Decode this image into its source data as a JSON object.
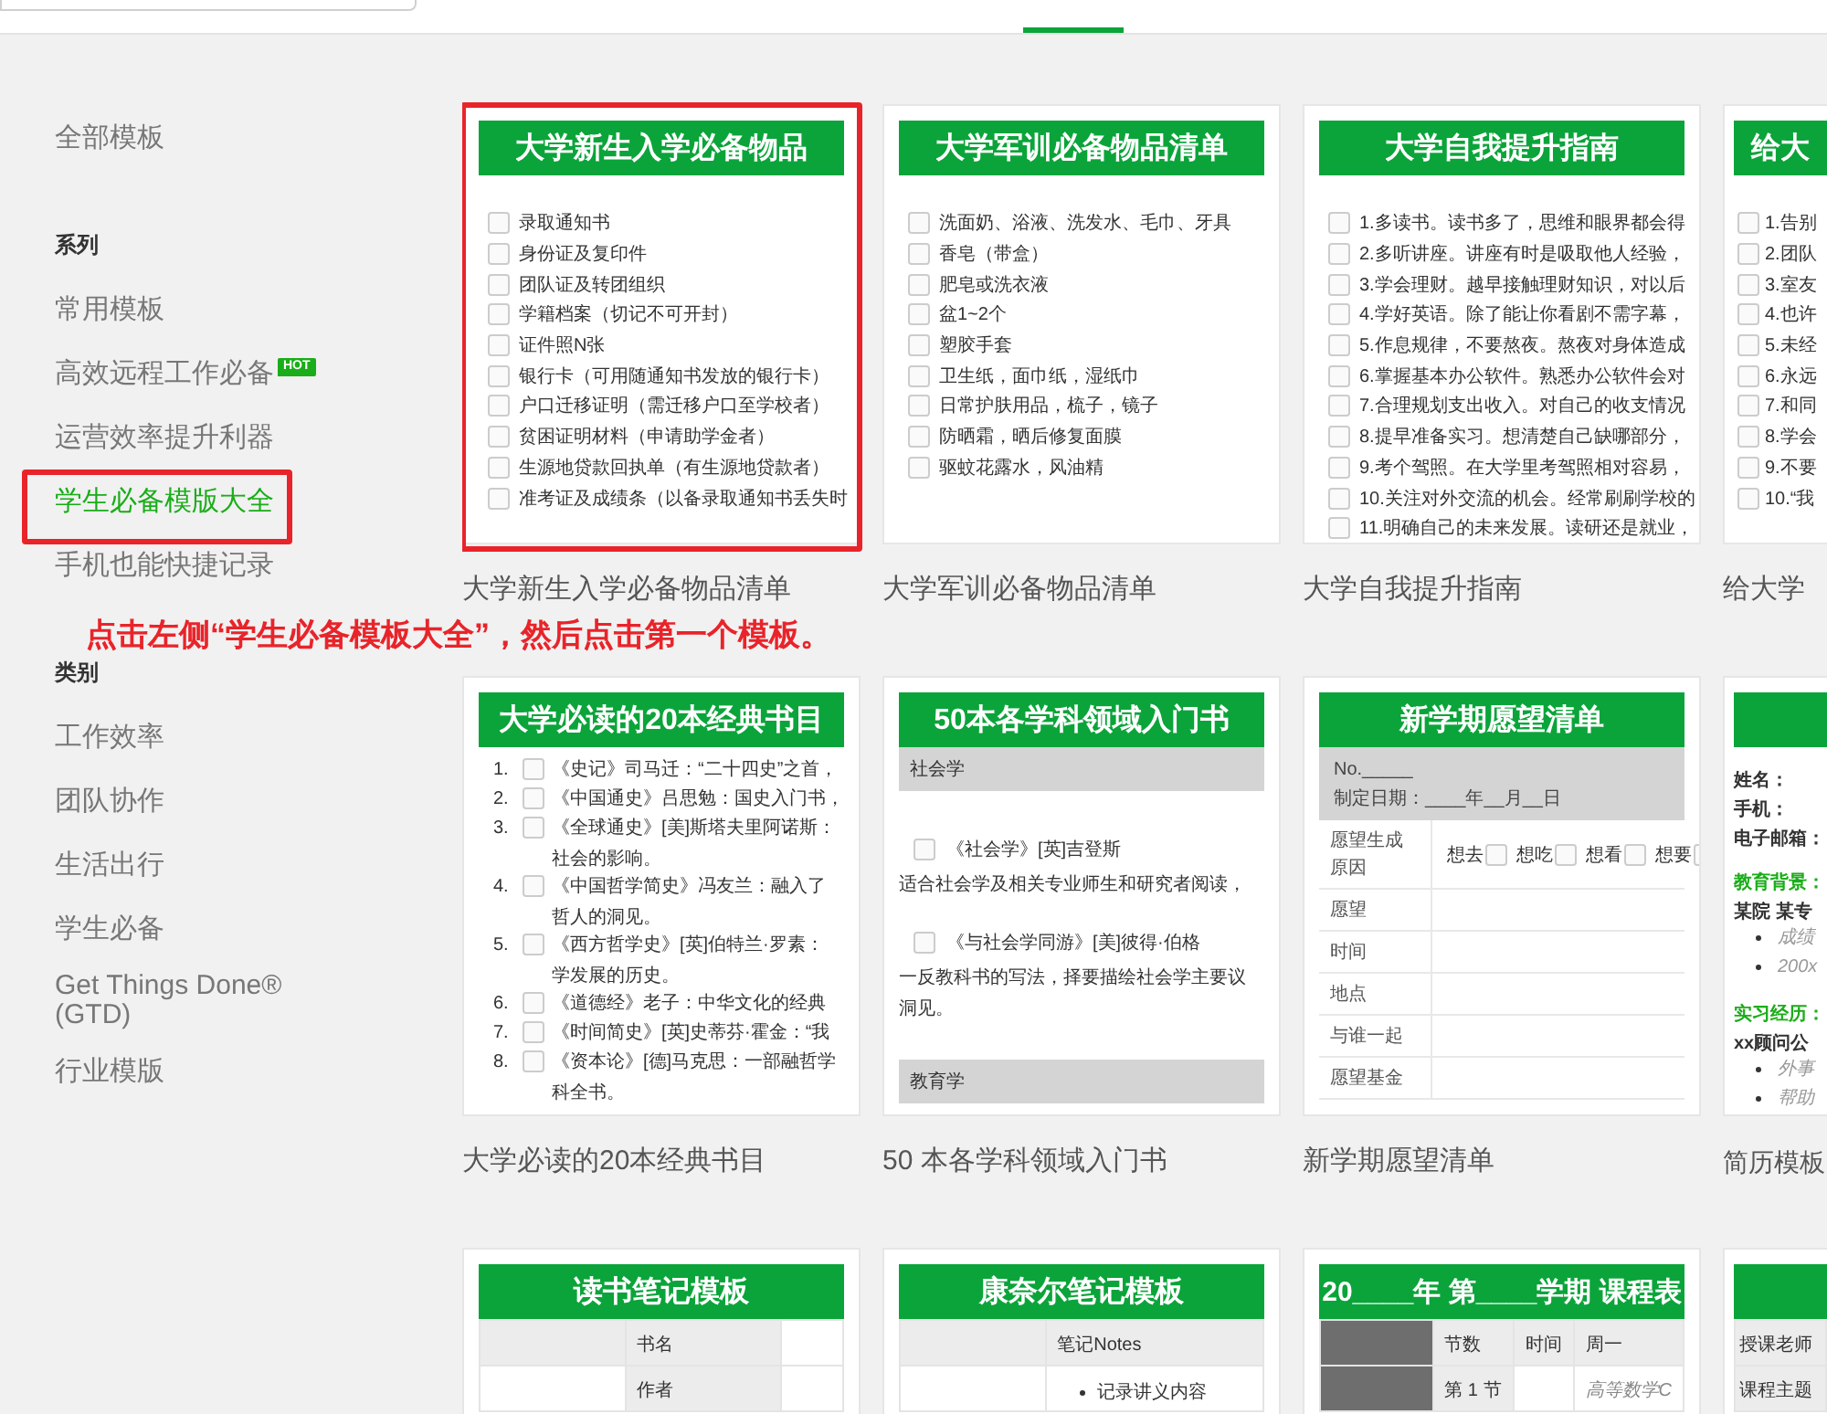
{
  "sidebar": {
    "top_items": [
      {
        "label": "全部模板",
        "selected": false,
        "highlighted": false
      }
    ],
    "sections": [
      {
        "heading": "系列",
        "items": [
          {
            "label": "常用模板",
            "selected": false,
            "highlighted": false
          },
          {
            "label": "高效远程工作必备",
            "selected": false,
            "highlighted": false,
            "badge": "HOT"
          },
          {
            "label": "运营效率提升利器",
            "selected": false,
            "highlighted": false
          },
          {
            "label": "学生必备模版大全",
            "selected": true,
            "highlighted": true
          },
          {
            "label": "手机也能快捷记录",
            "selected": false,
            "highlighted": false
          }
        ]
      },
      {
        "heading": "类别",
        "items": [
          {
            "label": "工作效率",
            "selected": false,
            "highlighted": false
          },
          {
            "label": "团队协作",
            "selected": false,
            "highlighted": false
          },
          {
            "label": "生活出行",
            "selected": false,
            "highlighted": false
          },
          {
            "label": "学生必备",
            "selected": false,
            "highlighted": false
          },
          {
            "label": "Get Things Done® (GTD)",
            "selected": false,
            "highlighted": false
          },
          {
            "label": "行业模版",
            "selected": false,
            "highlighted": false
          }
        ]
      }
    ]
  },
  "instruction": "点击左侧“学生必备模板大全”，然后点击第一个模板。",
  "templates": [
    {
      "caption": "大学新生入学必备物品清单",
      "highlighted": true,
      "preview": {
        "kind": "checklist",
        "title": "大学新生入学必备物品",
        "items": [
          "录取通知书",
          "身份证及复印件",
          "团队证及转团组织",
          "学籍档案（切记不可开封）",
          "证件照N张",
          "银行卡（可用随通知书发放的银行卡）",
          "户口迁移证明（需迁移户口至学校者）",
          "贫困证明材料（申请助学金者）",
          "生源地贷款回执单（有生源地贷款者）",
          "准考证及成绩条（以备录取通知书丢失时"
        ]
      }
    },
    {
      "caption": "大学军训必备物品清单",
      "highlighted": false,
      "preview": {
        "kind": "checklist",
        "title": "大学军训必备物品清单",
        "items": [
          "洗面奶、浴液、洗发水、毛巾、牙具",
          "香皂（带盒）",
          "肥皂或洗衣液",
          "盆1~2个",
          "塑胶手套",
          "卫生纸，面巾纸，湿纸巾",
          "日常护肤用品，梳子，镜子",
          "防晒霜，晒后修复面膜",
          "驱蚊花露水，风油精"
        ]
      }
    },
    {
      "caption": "大学自我提升指南",
      "highlighted": false,
      "preview": {
        "kind": "checklist",
        "title": "大学自我提升指南",
        "items": [
          "1.多读书。读书多了，思维和眼界都会得",
          "2.多听讲座。讲座有时是吸取他人经验，",
          "3.学会理财。越早接触理财知识，对以后",
          "4.学好英语。除了能让你看剧不需字幕，",
          "5.作息规律，不要熬夜。熬夜对身体造成",
          "6.掌握基本办公软件。熟悉办公软件会对",
          "7.合理规划支出收入。对自己的收支情况",
          "8.提早准备实习。想清楚自己缺哪部分，",
          "9.考个驾照。在大学里考驾照相对容易，",
          "10.关注对外交流的机会。经常刷刷学校的",
          "11.明确自己的未来发展。读研还是就业，"
        ]
      }
    },
    {
      "caption": "给大学",
      "highlighted": false,
      "preview": {
        "kind": "checklist",
        "title": "给大",
        "items": [
          "1.告别",
          "2.团队",
          "3.室友",
          "4.也许",
          "5.未经",
          "6.永远",
          "7.和同",
          "8.学会",
          "9.不要",
          "10.“我"
        ]
      }
    },
    {
      "caption": "大学必读的20本经典书目",
      "highlighted": false,
      "preview": {
        "kind": "booklist",
        "title": "大学必读的20本经典书目",
        "items": [
          {
            "number": "1.",
            "text": "《史记》司马迁：“二十四史”之首，"
          },
          {
            "number": "2.",
            "text": "《中国通史》吕思勉：国史入门书，"
          },
          {
            "number": "3.",
            "text": "《全球通史》[美]斯塔夫里阿诺斯：",
            "more": "社会的影响。"
          },
          {
            "number": "4.",
            "text": "《中国哲学简史》冯友兰：融入了",
            "more": "哲人的洞见。"
          },
          {
            "number": "5.",
            "text": "《西方哲学史》[英]伯特兰·罗素：",
            "more": "学发展的历史。"
          },
          {
            "number": "6.",
            "text": "《道德经》老子：中华文化的经典"
          },
          {
            "number": "7.",
            "text": "《时间简史》[英]史蒂芬·霍金：“我"
          },
          {
            "number": "8.",
            "text": "《资本论》[德]马克思：一部融哲学",
            "more": "科全书。"
          }
        ]
      }
    },
    {
      "caption": "50 本各学科领域入门书",
      "highlighted": false,
      "preview": {
        "kind": "sections",
        "title": "50本各学科领域入门书",
        "sections": [
          {
            "name": "社会学",
            "entries": [
              {
                "title": "《社会学》[英]吉登斯",
                "note": [
                  "适合社会学及相关专业师生和研究者阅读，"
                ]
              },
              {
                "title": "《与社会学同游》[美]彼得·伯格",
                "note": [
                  "一反教科书的写法，择要描绘社会学主要议",
                  "洞见。"
                ]
              }
            ]
          },
          {
            "name": "教育学"
          }
        ]
      }
    },
    {
      "caption": "新学期愿望清单",
      "highlighted": false,
      "preview": {
        "kind": "form",
        "title": "新学期愿望清单",
        "meta": [
          "No._____",
          "制定日期：____年__月__日"
        ],
        "rows": [
          {
            "label": "愿望生成原因",
            "options": [
              "想去",
              "想吃",
              "想看",
              "想要"
            ]
          },
          {
            "label": "愿望"
          },
          {
            "label": "时间"
          },
          {
            "label": "地点"
          },
          {
            "label": "与谁一起"
          },
          {
            "label": "愿望基金"
          }
        ]
      }
    },
    {
      "caption": "简历模板",
      "highlighted": false,
      "preview": {
        "kind": "resume",
        "lines": [
          {
            "kind": "field",
            "text": "姓名："
          },
          {
            "kind": "field",
            "text": "手机："
          },
          {
            "kind": "field",
            "text": "电子邮箱："
          },
          {
            "kind": "heading",
            "text": "教育背景："
          },
          {
            "kind": "text",
            "text": "某院 某专"
          },
          {
            "kind": "bullet",
            "text": "成绩"
          },
          {
            "kind": "bullet",
            "text": "200x"
          },
          {
            "kind": "heading",
            "text": "实习经历："
          },
          {
            "kind": "text",
            "text": "xx顾问公"
          },
          {
            "kind": "bullet",
            "text": "外事"
          },
          {
            "kind": "bullet",
            "text": "帮助"
          }
        ]
      }
    },
    {
      "highlighted": false,
      "preview": {
        "kind": "table",
        "title": "读书笔记模板",
        "rows": [
          [
            {
              "kind": "light"
            },
            {
              "text": "书名",
              "kind": "light"
            },
            {
              "kind": "plain"
            }
          ],
          [
            {
              "kind": "plain"
            },
            {
              "text": "作者",
              "kind": "light"
            },
            {
              "kind": "plain"
            }
          ]
        ]
      }
    },
    {
      "highlighted": false,
      "preview": {
        "kind": "table",
        "title": "康奈尔笔记模板",
        "rows": [
          [
            {
              "kind": "light"
            },
            {
              "text": "笔记Notes",
              "kind": "light"
            }
          ],
          [
            {
              "kind": "plain"
            },
            {
              "bullets": [
                "记录讲义内容"
              ],
              "kind": "plain"
            }
          ]
        ]
      }
    },
    {
      "highlighted": false,
      "preview": {
        "kind": "table",
        "title": "20____年 第____学期 课程表",
        "rows": [
          [
            {
              "kind": "dark"
            },
            {
              "text": "节数",
              "kind": "light"
            },
            {
              "text": "时间",
              "kind": "light"
            },
            {
              "text": "周一",
              "kind": "light"
            }
          ],
          [
            {
              "kind": "dark"
            },
            {
              "text": "第 1 节",
              "kind": "light"
            },
            {
              "kind": "plain"
            },
            {
              "text": "高等数学C",
              "kind": "plain",
              "italic": true
            }
          ]
        ]
      }
    },
    {
      "highlighted": false,
      "preview": {
        "kind": "table",
        "rows": [
          [
            {
              "text": "授课老师",
              "kind": "light"
            }
          ],
          [
            {
              "text": "课程主题",
              "kind": "light"
            }
          ]
        ]
      }
    }
  ]
}
